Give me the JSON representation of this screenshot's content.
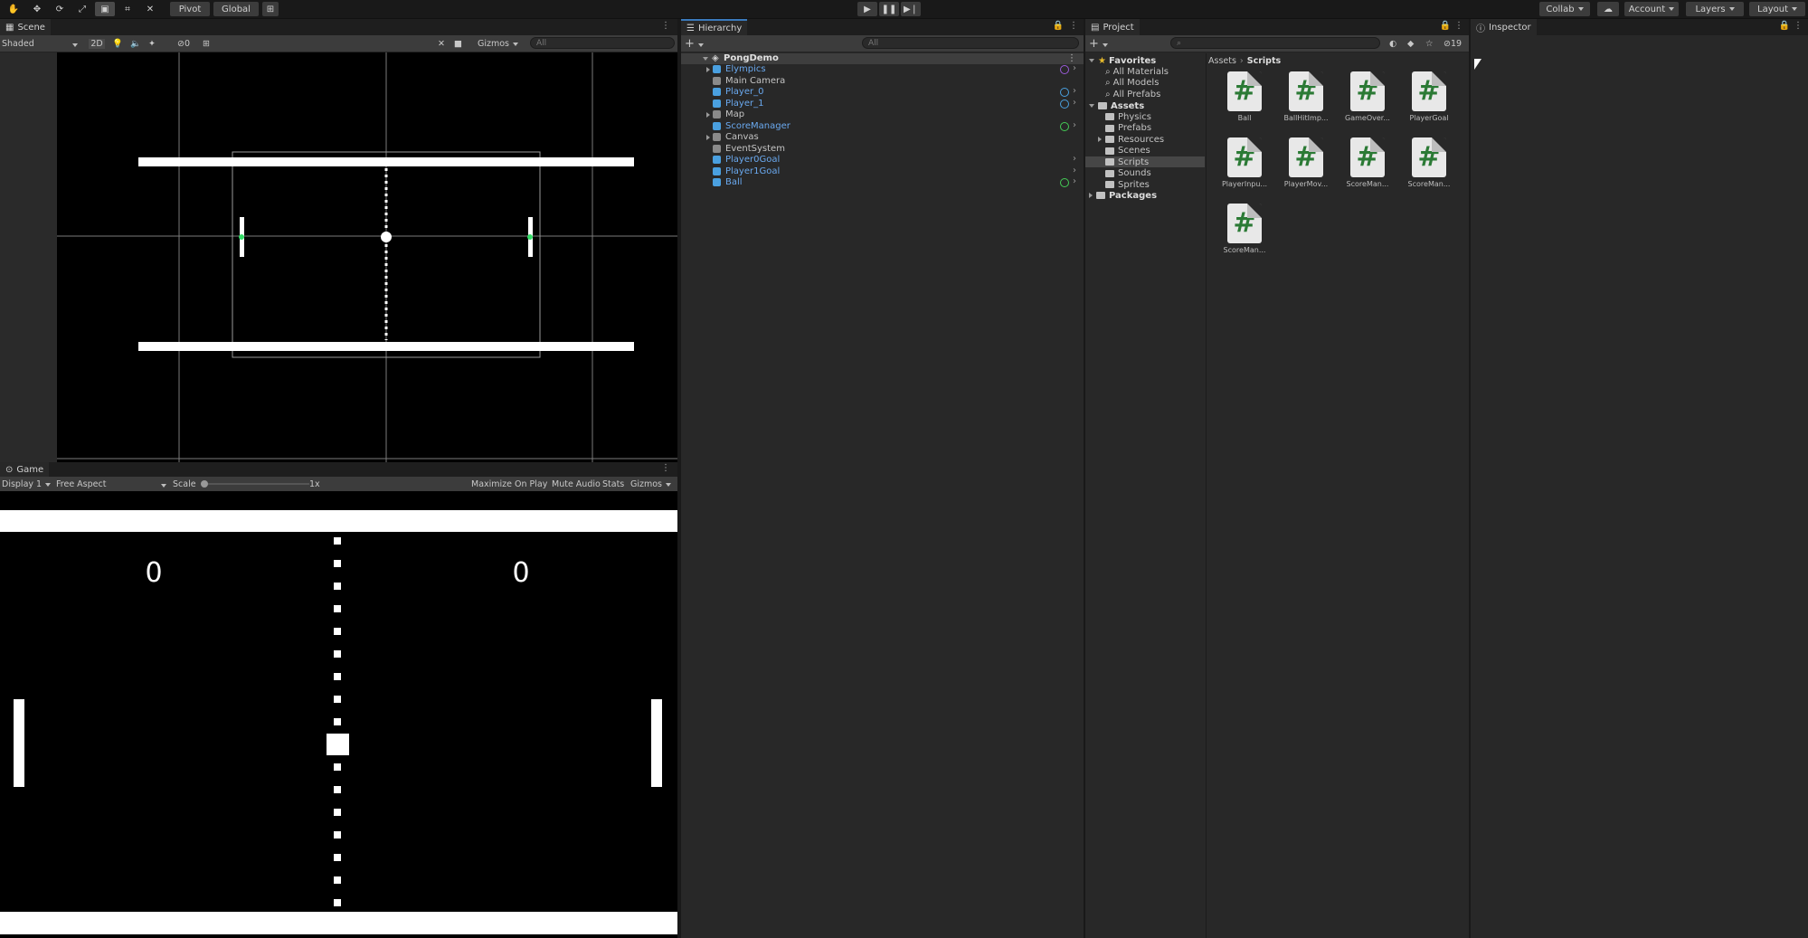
{
  "toolbar": {
    "pivot": "Pivot",
    "global": "Global",
    "collab": "Collab",
    "account": "Account",
    "layers": "Layers",
    "layout": "Layout"
  },
  "scene": {
    "tab": "Scene",
    "shading": "Shaded",
    "mode2d": "2D",
    "hidden_count": "0",
    "gizmos": "Gizmos",
    "search_placeholder": "All"
  },
  "game": {
    "tab": "Game",
    "display": "Display 1",
    "aspect": "Free Aspect",
    "scale_label": "Scale",
    "scale_value": "1x",
    "maximize": "Maximize On Play",
    "mute": "Mute Audio",
    "stats": "Stats",
    "gizmos": "Gizmos",
    "score_left": "0",
    "score_right": "0"
  },
  "hierarchy": {
    "tab": "Hierarchy",
    "search_placeholder": "All",
    "scene_name": "PongDemo",
    "items": [
      {
        "label": "Elympics",
        "kind": "prefab",
        "fold": true
      },
      {
        "label": "Main Camera",
        "kind": "object",
        "fold": false
      },
      {
        "label": "Player_0",
        "kind": "prefab",
        "fold": false
      },
      {
        "label": "Player_1",
        "kind": "prefab",
        "fold": false
      },
      {
        "label": "Map",
        "kind": "object",
        "fold": true
      },
      {
        "label": "ScoreManager",
        "kind": "prefab",
        "fold": false
      },
      {
        "label": "Canvas",
        "kind": "object",
        "fold": true
      },
      {
        "label": "EventSystem",
        "kind": "object",
        "fold": false
      },
      {
        "label": "Player0Goal",
        "kind": "prefab",
        "fold": false
      },
      {
        "label": "Player1Goal",
        "kind": "prefab",
        "fold": false
      },
      {
        "label": "Ball",
        "kind": "prefab",
        "fold": false
      }
    ]
  },
  "project": {
    "tab": "Project",
    "hidden_count": "19",
    "favorites_label": "Favorites",
    "favorites": [
      "All Materials",
      "All Models",
      "All Prefabs"
    ],
    "assets_label": "Assets",
    "asset_folders": [
      "Physics",
      "Prefabs",
      "Resources",
      "Scenes",
      "Scripts",
      "Sounds",
      "Sprites"
    ],
    "packages_label": "Packages",
    "breadcrumb": [
      "Assets",
      "Scripts"
    ],
    "scripts": [
      "Ball",
      "BallHitImp...",
      "GameOver...",
      "PlayerGoal",
      "PlayerInpu...",
      "PlayerMov...",
      "ScoreMan...",
      "ScoreMan...",
      "ScoreMan..."
    ],
    "script_glyph": "#"
  },
  "inspector": {
    "tab": "Inspector"
  }
}
